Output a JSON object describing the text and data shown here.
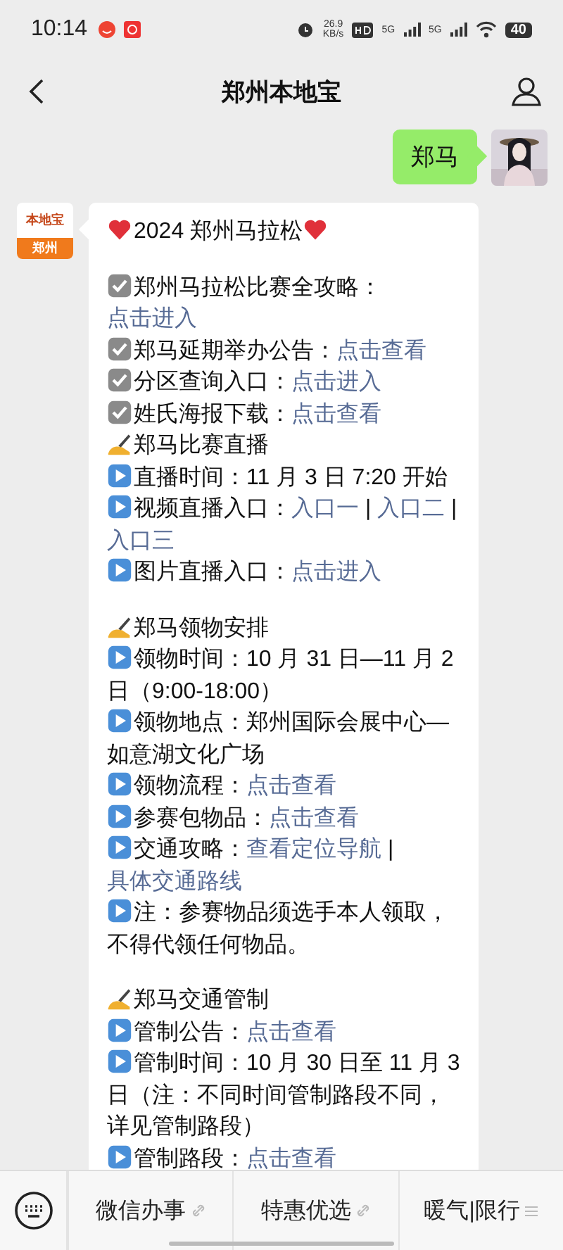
{
  "status_bar": {
    "time": "10:14",
    "speed": "26.9",
    "speed_unit": "KB/s",
    "network_labels": [
      "5G",
      "5G"
    ],
    "battery": "40"
  },
  "header": {
    "title": "郑州本地宝"
  },
  "sent_message": {
    "text": "郑马"
  },
  "received_message": {
    "sender": {
      "logo_text": "本地宝",
      "city": "郑州"
    },
    "title": {
      "kind": "heart",
      "text": "2024 郑州马拉松"
    },
    "sections": [
      [
        {
          "kind": "check",
          "parts": [
            {
              "text": "郑州马拉松比赛全攻略：",
              "link": false
            },
            {
              "text": "点击进入",
              "link": true
            }
          ]
        },
        {
          "kind": "check",
          "parts": [
            {
              "text": "郑马延期举办公告：",
              "link": false
            },
            {
              "text": "点击查看",
              "link": true
            }
          ]
        },
        {
          "kind": "check",
          "parts": [
            {
              "text": "分区查询入口：",
              "link": false
            },
            {
              "text": "点击进入",
              "link": true
            }
          ]
        },
        {
          "kind": "check",
          "parts": [
            {
              "text": "姓氏海报下载：",
              "link": false
            },
            {
              "text": "点击查看",
              "link": true
            }
          ]
        },
        {
          "kind": "pen",
          "parts": [
            {
              "text": "郑马比赛直播",
              "link": false
            }
          ]
        },
        {
          "kind": "play",
          "parts": [
            {
              "text": "直播时间：11 月 3 日 7:20 开始",
              "link": false
            }
          ]
        },
        {
          "kind": "play",
          "parts": [
            {
              "text": "视频直播入口：",
              "link": false
            },
            {
              "text": "入口一",
              "link": true
            },
            {
              "text": " | ",
              "link": false
            },
            {
              "text": "入口二",
              "link": true
            },
            {
              "text": " | ",
              "link": false
            },
            {
              "text": "入口三",
              "link": true
            }
          ]
        },
        {
          "kind": "play",
          "parts": [
            {
              "text": "图片直播入口：",
              "link": false
            },
            {
              "text": "点击进入",
              "link": true
            }
          ]
        }
      ],
      [
        {
          "kind": "pen",
          "parts": [
            {
              "text": "郑马领物安排",
              "link": false
            }
          ]
        },
        {
          "kind": "play",
          "parts": [
            {
              "text": "领物时间：10 月 31 日—11 月 2 日（9:00-18:00）",
              "link": false
            }
          ]
        },
        {
          "kind": "play",
          "parts": [
            {
              "text": "领物地点：郑州国际会展中心—如意湖文化广场",
              "link": false
            }
          ]
        },
        {
          "kind": "play",
          "parts": [
            {
              "text": "领物流程：",
              "link": false
            },
            {
              "text": "点击查看",
              "link": true
            }
          ]
        },
        {
          "kind": "play",
          "parts": [
            {
              "text": "参赛包物品：",
              "link": false
            },
            {
              "text": "点击查看",
              "link": true
            }
          ]
        },
        {
          "kind": "play",
          "parts": [
            {
              "text": "交通攻略：",
              "link": false
            },
            {
              "text": "查看定位导航",
              "link": true
            },
            {
              "text": " | ",
              "link": false
            },
            {
              "text": "具体交通路线",
              "link": true
            }
          ]
        },
        {
          "kind": "play",
          "parts": [
            {
              "text": "注：参赛物品须选手本人领取，不得代领任何物品。",
              "link": false
            }
          ]
        }
      ],
      [
        {
          "kind": "pen",
          "parts": [
            {
              "text": "郑马交通管制",
              "link": false
            }
          ]
        },
        {
          "kind": "play",
          "parts": [
            {
              "text": "管制公告：",
              "link": false
            },
            {
              "text": "点击查看",
              "link": true
            }
          ]
        },
        {
          "kind": "play",
          "parts": [
            {
              "text": "管制时间：10 月 30 日至 11 月 3 日（注：不同时间管制路段不同，详见管制路段）",
              "link": false
            }
          ]
        },
        {
          "kind": "play",
          "parts": [
            {
              "text": "管制路段：",
              "link": false
            },
            {
              "text": "点击查看",
              "link": true
            }
          ]
        }
      ]
    ]
  },
  "bottom_menu": [
    {
      "label": "微信办事",
      "kind": "link"
    },
    {
      "label": "特惠优选",
      "kind": "link"
    },
    {
      "label": "暖气|限行",
      "kind": "submenu"
    }
  ]
}
